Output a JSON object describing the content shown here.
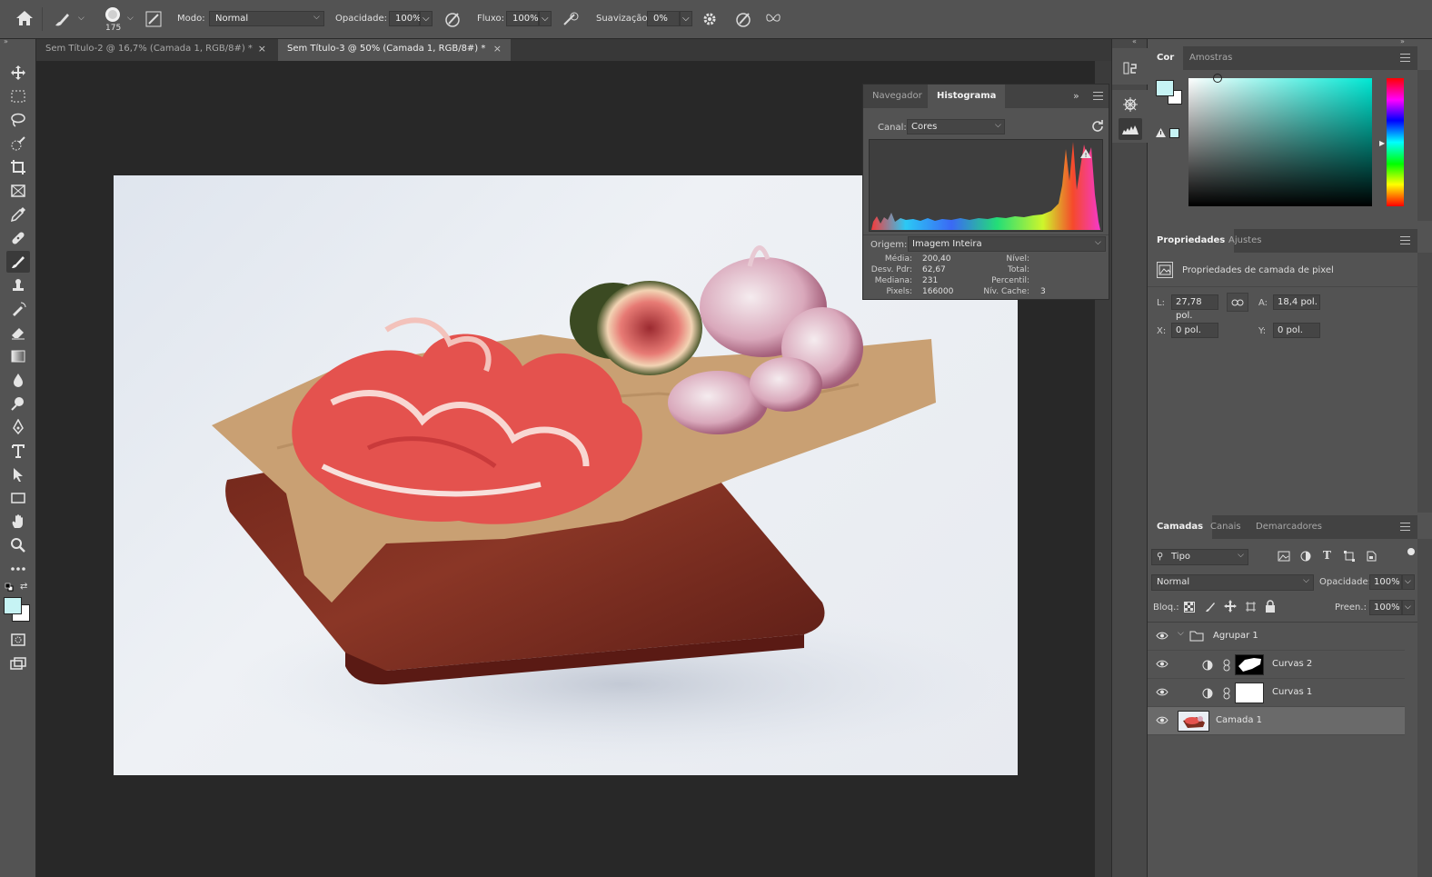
{
  "options_bar": {
    "brush_size": "175",
    "mode_label": "Modo:",
    "mode_value": "Normal",
    "opacity_label": "Opacidade:",
    "opacity_value": "100%",
    "flow_label": "Fluxo:",
    "flow_value": "100%",
    "smoothing_label": "Suavização:",
    "smoothing_value": "0%"
  },
  "document_tabs": [
    {
      "label": "Sem Título-2 @ 16,7% (Camada 1, RGB/8#) *",
      "close": "×"
    },
    {
      "label": "Sem Título-3 @ 50% (Camada 1, RGB/8#) *",
      "close": "×"
    }
  ],
  "histogram_panel": {
    "tabs": [
      "Navegador",
      "Histograma"
    ],
    "active_tab": "Histograma",
    "channel_label": "Canal:",
    "channel_value": "Cores",
    "source_label": "Origem:",
    "source_value": "Imagem Inteira",
    "stats_left": [
      {
        "label": "Média:",
        "value": "200,40"
      },
      {
        "label": "Desv. Pdr:",
        "value": "62,67"
      },
      {
        "label": "Mediana:",
        "value": "231"
      },
      {
        "label": "Pixels:",
        "value": "166000"
      }
    ],
    "stats_right": [
      {
        "label": "Nível:",
        "value": ""
      },
      {
        "label": "Total:",
        "value": ""
      },
      {
        "label": "Percentil:",
        "value": ""
      },
      {
        "label": "Nív. Cache:",
        "value": "3"
      }
    ]
  },
  "color_panel": {
    "tabs": [
      "Cor",
      "Amostras"
    ],
    "active_tab": "Cor",
    "foreground_color": "#c6f3f4",
    "hue_color": "#00e8d4"
  },
  "properties_panel": {
    "tabs": [
      "Propriedades",
      "Ajustes"
    ],
    "active_tab": "Propriedades",
    "layer_type": "Propriedades de camada de pixel",
    "w_label": "L:",
    "w_value": "27,78 pol.",
    "h_label": "A:",
    "h_value": "18,4 pol.",
    "x_label": "X:",
    "x_value": "0 pol.",
    "y_label": "Y:",
    "y_value": "0 pol."
  },
  "layers_panel": {
    "tabs": [
      "Camadas",
      "Canais",
      "Demarcadores"
    ],
    "active_tab": "Camadas",
    "filter_kind": "Tipo",
    "blend_mode": "Normal",
    "opacity_label": "Opacidade:",
    "opacity_value": "100%",
    "lock_label": "Bloq.:",
    "fill_label": "Preen.:",
    "fill_value": "100%",
    "layers": [
      {
        "name": "Agrupar 1",
        "kind": "group"
      },
      {
        "name": "Curvas 2",
        "kind": "curves"
      },
      {
        "name": "Curvas 1",
        "kind": "curves"
      },
      {
        "name": "Camada 1",
        "kind": "pixel",
        "selected": true
      }
    ]
  },
  "colors": {
    "ui_dark": "#535353",
    "canvas_bg": "#282828",
    "accent_cyan": "#c6f3f4"
  }
}
